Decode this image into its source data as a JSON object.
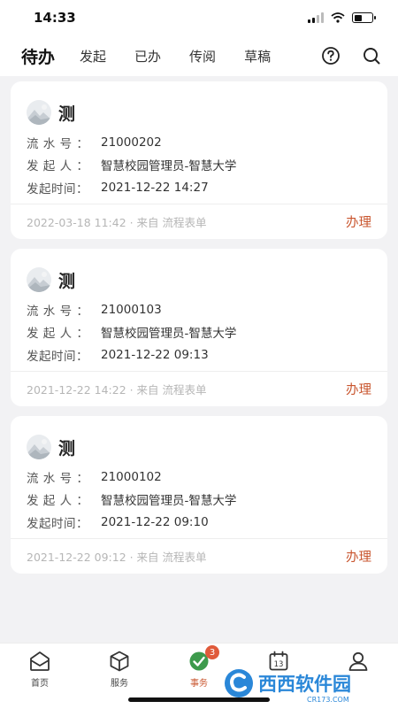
{
  "status_bar": {
    "time": "14:33"
  },
  "header": {
    "tabs": [
      {
        "label": "待办",
        "active": true
      },
      {
        "label": "发起",
        "active": false
      },
      {
        "label": "已办",
        "active": false
      },
      {
        "label": "传阅",
        "active": false
      },
      {
        "label": "草稿",
        "active": false
      }
    ],
    "help_icon": "question-circle-icon",
    "search_icon": "search-icon"
  },
  "tasks": [
    {
      "title": "测",
      "serial_label": "流 水 号 ：",
      "serial": "21000202",
      "initiator_label": "发 起 人 ：",
      "initiator": "智慧校园管理员-智慧大学",
      "time_label": "发起时间：",
      "time": "2021-12-22 14:27",
      "meta": "2022-03-18 11:42 · 来自  流程表单",
      "action": "办理"
    },
    {
      "title": "测",
      "serial_label": "流 水 号 ：",
      "serial": "21000103",
      "initiator_label": "发 起 人 ：",
      "initiator": "智慧校园管理员-智慧大学",
      "time_label": "发起时间：",
      "time": "2021-12-22 09:13",
      "meta": "2021-12-22 14:22 · 来自  流程表单",
      "action": "办理"
    },
    {
      "title": "测",
      "serial_label": "流 水 号 ：",
      "serial": "21000102",
      "initiator_label": "发 起 人 ：",
      "initiator": "智慧校园管理员-智慧大学",
      "time_label": "发起时间：",
      "time": "2021-12-22 09:10",
      "meta": "2021-12-22 09:12 · 来自  流程表单",
      "action": "办理"
    }
  ],
  "bottom_nav": [
    {
      "label": "首页",
      "icon": "home-icon"
    },
    {
      "label": "服务",
      "icon": "box-icon"
    },
    {
      "label": "事务",
      "icon": "tasks-icon",
      "badge": "3",
      "active": true
    },
    {
      "label": "",
      "icon": "calendar-icon",
      "calendar_day": "13"
    },
    {
      "label": "",
      "icon": "user-icon"
    }
  ],
  "watermark": {
    "text": "西西软件园",
    "sub": "CR173.COM"
  },
  "colors": {
    "accent": "#c9562f",
    "badge": "#e05a3a",
    "background": "#f2f2f4"
  }
}
